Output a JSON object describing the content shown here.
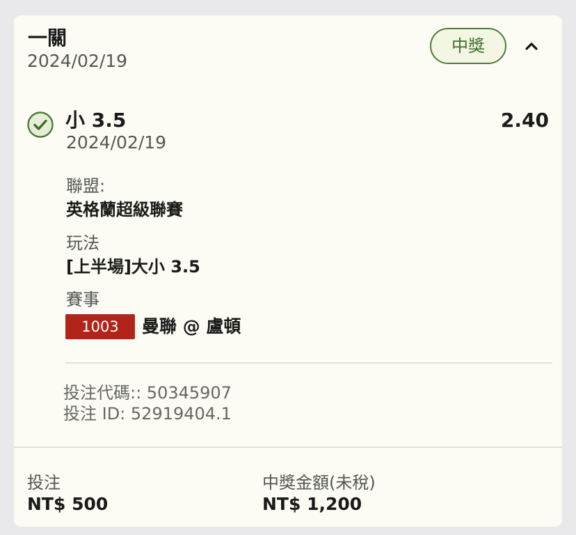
{
  "header": {
    "bet_type": "一關",
    "date": "2024/02/19",
    "status": "中獎",
    "collapse_icon": "chevron-up-icon"
  },
  "selection": {
    "status_icon": "check-circle-icon",
    "pick": "小 3.5",
    "odds": "2.40",
    "date": "2024/02/19",
    "league_label": "聯盟:",
    "league": "英格蘭超級聯賽",
    "play_label": "玩法",
    "play": "[上半場]大小 3.5",
    "event_label": "賽事",
    "match_code": "1003",
    "match": "曼聯 @ 盧頓"
  },
  "meta": {
    "bet_code": "投注代碼:: 50345907",
    "bet_id": "投注 ID: 52919404.1"
  },
  "summary": {
    "stake_label": "投注",
    "stake": "NT$ 500",
    "payout_label": "中獎金額(未稅)",
    "payout": "NT$ 1,200"
  },
  "colors": {
    "accent_green": "#4c7a3a",
    "badge_red": "#b22419",
    "card_bg": "#fcfcf4"
  }
}
